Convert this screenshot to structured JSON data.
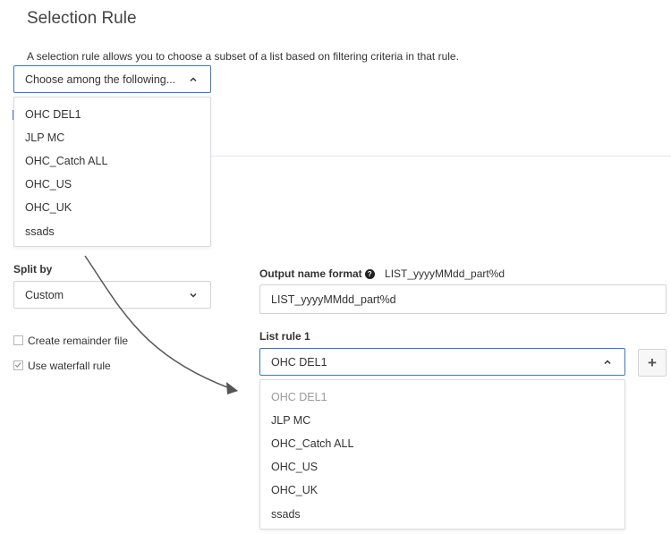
{
  "page": {
    "title": "Selection Rule",
    "description": "A selection rule allows you to choose a subset of a list based on filtering criteria in that rule."
  },
  "top_select": {
    "placeholder": "Choose among the following...",
    "options": [
      "OHC DEL1",
      "JLP MC",
      "OHC_Catch ALL",
      "OHC_US",
      "OHC_UK",
      "ssads"
    ]
  },
  "split_by": {
    "label": "Split by",
    "value": "Custom"
  },
  "checkboxes": {
    "create_remainder": {
      "label": "Create remainder file",
      "checked": false
    },
    "use_waterfall": {
      "label": "Use waterfall rule",
      "checked": true
    }
  },
  "output_name": {
    "label": "Output name format",
    "example": "LIST_yyyyMMdd_part%d",
    "value": "LIST_yyyyMMdd_part%d"
  },
  "list_rule": {
    "label": "List rule 1",
    "value": "OHC DEL1",
    "options": [
      "OHC DEL1",
      "JLP MC",
      "OHC_Catch ALL",
      "OHC_US",
      "OHC_UK",
      "ssads"
    ],
    "add_symbol": "+"
  },
  "colors": {
    "accent": "#3a78c4",
    "border": "#d0d4d9",
    "arrow": "#555555"
  }
}
